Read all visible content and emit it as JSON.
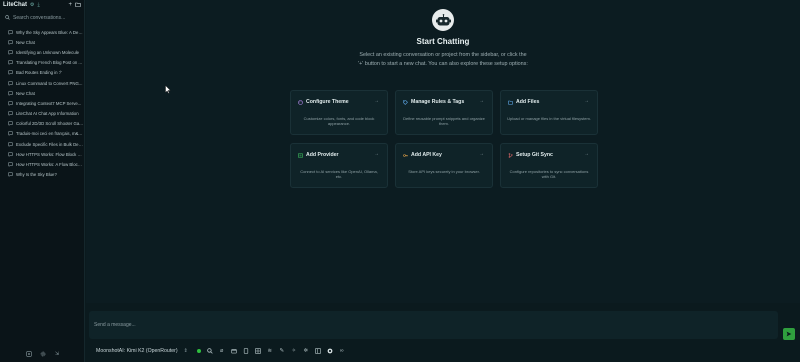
{
  "app": {
    "title": "LiteChat"
  },
  "sidebar": {
    "title": "LiteChat",
    "search_placeholder": "Search conversations...",
    "conversations": [
      "Why the Sky Appears Blue: A Deta...",
      "New Chat",
      "Identifying an Unknown Molecule",
      "Translating French Blog Post on ...",
      "Bad Routes Ending in '/'",
      "Linux Command to Convert PNG...",
      "New Chat",
      "Integrating Context7 MCP Serve...",
      "LiteChat AI Chat App Information",
      "Colorful 2D/3D Scroll Shooter Ga...",
      "Traduis-moi ceci en français, m&...",
      "Exclude Specific Files in Bulk Del...",
      "How HTTPS Works: Flow Block Ex...",
      "How HTTPS Works: A Flow Block ...",
      "Why Is the Sky Blue?"
    ]
  },
  "main": {
    "title": "Start Chatting",
    "subtitle": "Select an existing conversation or project from the sidebar, or click the '+' button to start a new chat. You can also explore these setup options:",
    "cards": [
      {
        "title": "Configure Theme",
        "desc": "Customize colors, fonts, and code block appearance.",
        "icon": "palette-icon",
        "color": "#b78cf0"
      },
      {
        "title": "Manage Rules & Tags",
        "desc": "Define reusable prompt snippets and organize them.",
        "icon": "tag-icon",
        "color": "#5fa8e8"
      },
      {
        "title": "Add Files",
        "desc": "Upload or manage files in the virtual filesystem.",
        "icon": "file-icon",
        "color": "#5fa8e8"
      },
      {
        "title": "Add Provider",
        "desc": "Connect to AI services like OpenAI, Ollama, etc.",
        "icon": "provider-icon",
        "color": "#3fbf5f"
      },
      {
        "title": "Add API Key",
        "desc": "Store API keys securely in your browser.",
        "icon": "key-icon",
        "color": "#e8a64a"
      },
      {
        "title": "Setup Git Sync",
        "desc": "Configure repositories to sync conversations with Git.",
        "icon": "git-icon",
        "color": "#e86a6a"
      }
    ]
  },
  "input": {
    "placeholder": "Send a message...",
    "model": "MoonshotAI: Kimi K2 (OpenRouter)"
  },
  "colors": {
    "accent": "#2f9e3e",
    "status_dot": "#2fbf3f",
    "background": "#0c1c21"
  }
}
